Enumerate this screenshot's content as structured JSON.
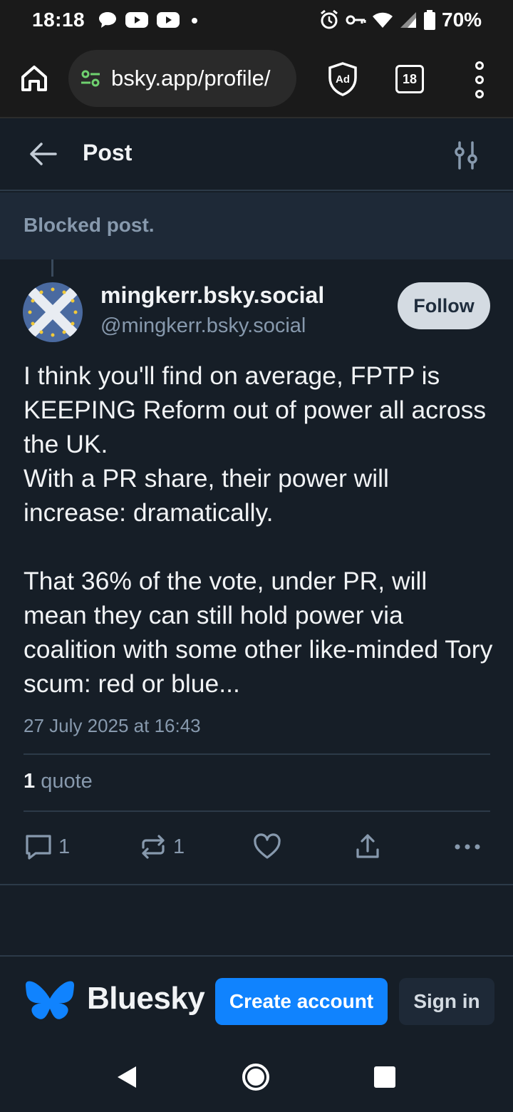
{
  "status_bar": {
    "time": "18:18",
    "battery": "70%",
    "icons": [
      "chat-bubble-icon",
      "youtube-icon",
      "youtube-icon",
      "dot-icon",
      "alarm-icon",
      "key-icon",
      "wifi-icon",
      "signal-icon",
      "battery-icon"
    ]
  },
  "browser": {
    "url": "bsky.app/profile/",
    "tab_count": "18",
    "ad_label": "Ad"
  },
  "header": {
    "title": "Post"
  },
  "blocked": {
    "text": "Blocked post."
  },
  "post": {
    "author_name": "mingkerr.bsky.social",
    "author_handle": "@mingkerr.bsky.social",
    "follow_label": "Follow",
    "text": "I think you'll find on average, FPTP is KEEPING Reform out of power all across the UK.\nWith a PR share, their power will increase: dramatically.\n\nThat 36% of the vote, under PR, will mean they can still hold power via coalition with some other like-minded Tory scum: red or blue...",
    "timestamp": "27 July 2025 at 16:43",
    "quote_count": "1",
    "quote_label": "quote",
    "reply_count": "1",
    "repost_count": "1"
  },
  "footer": {
    "brand": "Bluesky",
    "create_account": "Create account",
    "sign_in": "Sign in"
  },
  "colors": {
    "background": "#161e27",
    "accent": "#1083fe",
    "muted_text": "#8799ad",
    "url_icon": "#6fd16f"
  }
}
